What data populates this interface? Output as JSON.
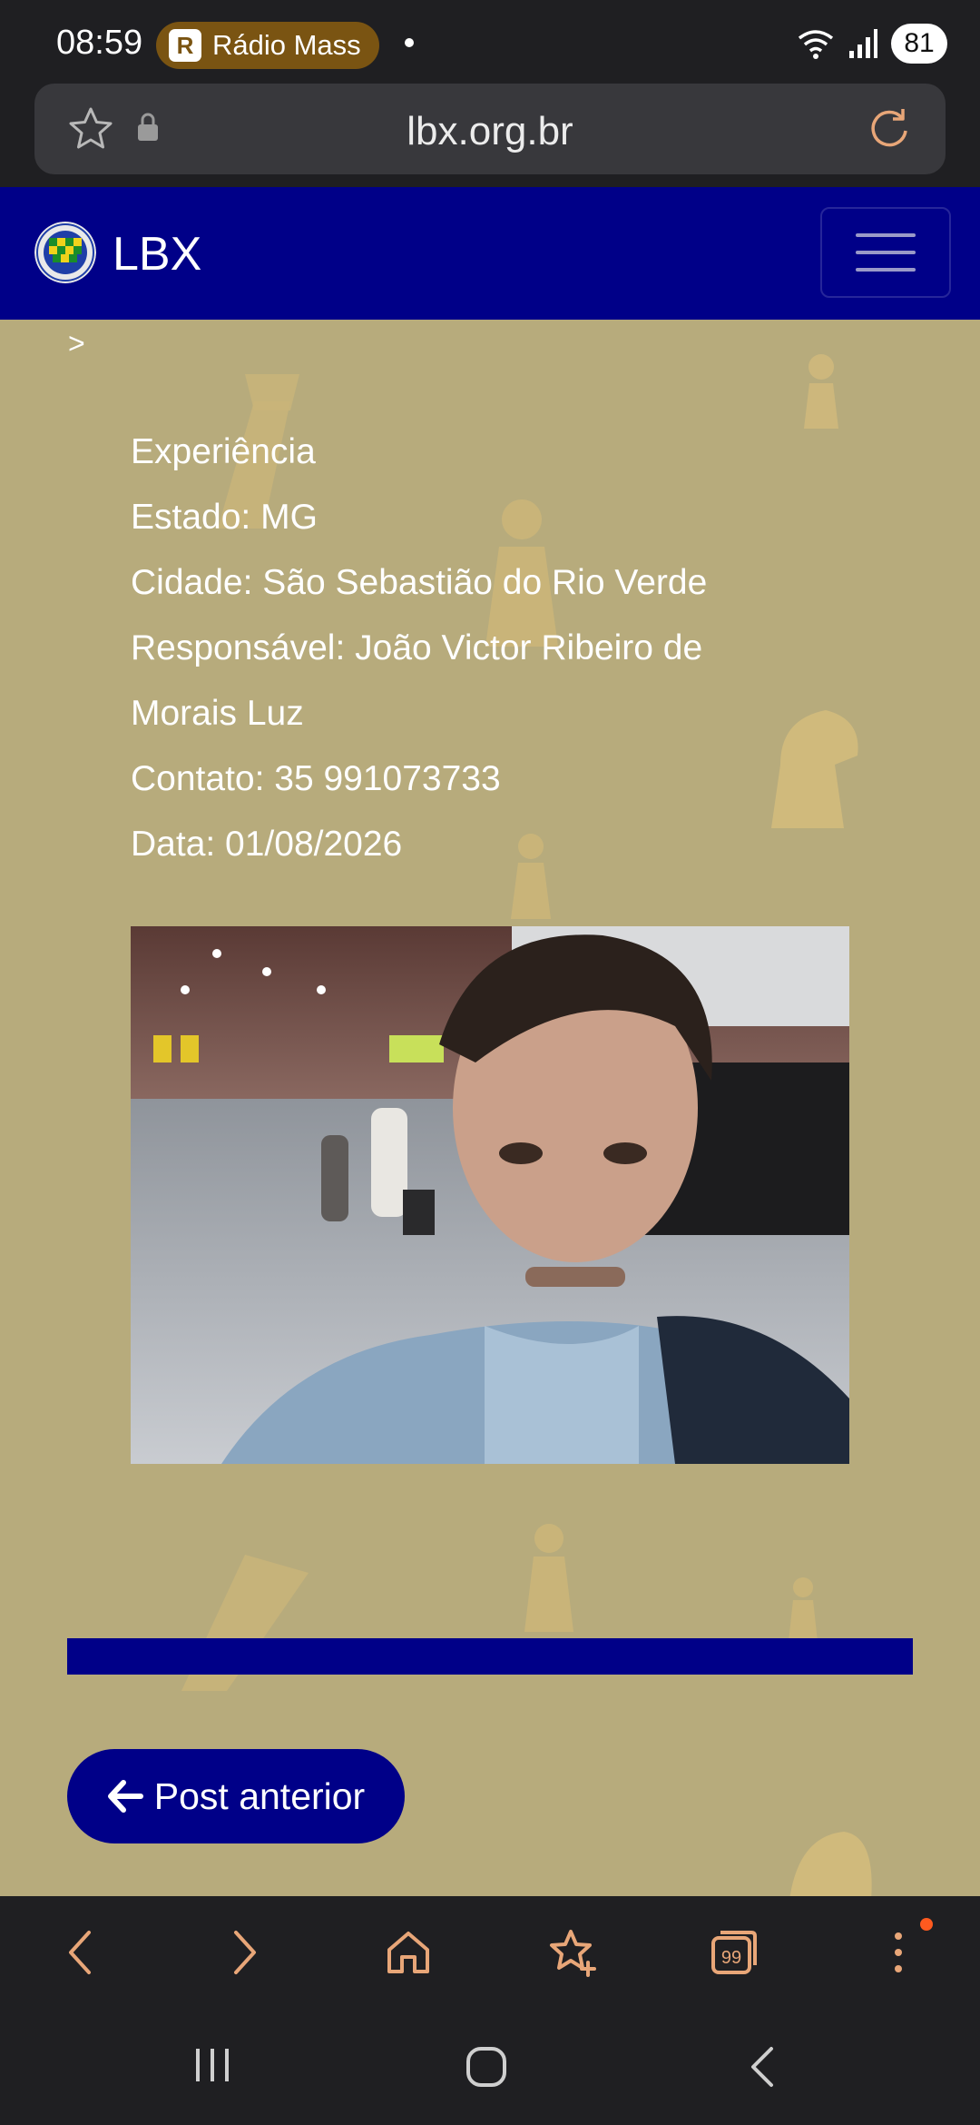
{
  "status_bar": {
    "time": "08:59",
    "radio_label": "Rádio Mass",
    "battery": "81"
  },
  "browser": {
    "url": "lbx.org.br"
  },
  "site": {
    "brand": "LBX"
  },
  "breadcrumb": ">",
  "post": {
    "title": "Experiência",
    "estado": "Estado: MG",
    "cidade": "Cidade: São Sebastião do Rio Verde",
    "responsavel": "Responsável: João Victor Ribeiro de Morais Luz",
    "contato": "Contato: 35 991073733",
    "data": "Data: 01/08/2026"
  },
  "navigation": {
    "prev_label": "Post anterior"
  },
  "colors": {
    "nav_blue": "#000088",
    "page_bg": "#b7ab7c",
    "system_bar": "#1f1f22",
    "accent_dot": "#ff5a1f"
  },
  "icons": {
    "bookmark": "star-icon",
    "secure": "lock-icon",
    "reload": "reload-icon",
    "menu": "hamburger-icon",
    "prev": "arrow-left-icon",
    "toolbar": [
      "back-icon",
      "forward-icon",
      "home-icon",
      "bookmarks-icon",
      "tabs-icon",
      "more-icon"
    ]
  }
}
